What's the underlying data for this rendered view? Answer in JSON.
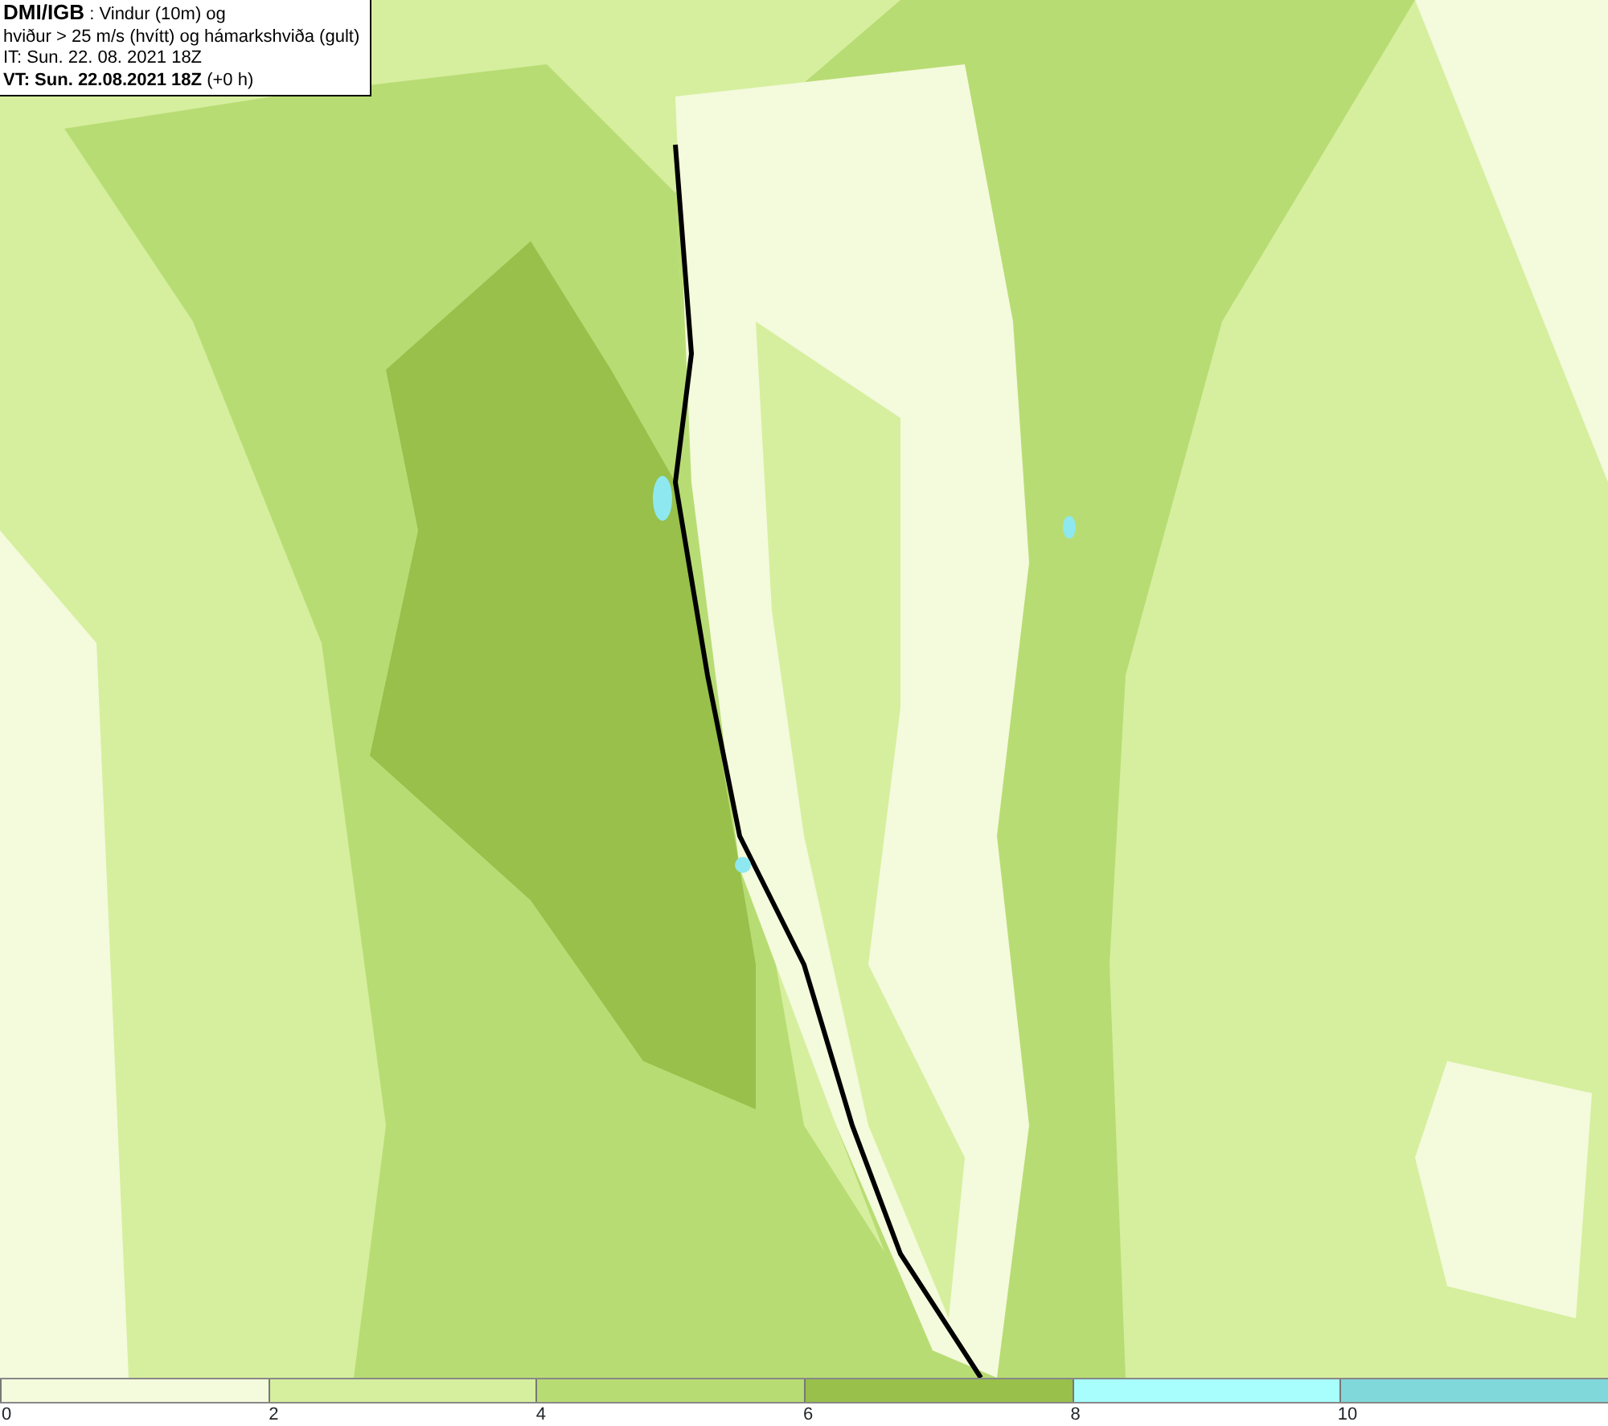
{
  "header": {
    "lines": [
      "**DMI/IGB** : Vindur (10m) og",
      "hviður > 25 m/s (hvítt) og hámarkshviða (gult)",
      "IT: Sun. 22. 08. 2021 18Z",
      "**VT: Sun. 22.08.2021 18Z** (+0 h)"
    ]
  },
  "legend": {
    "bins": [
      {
        "color": "#f4fadc"
      },
      {
        "color": "#d6ef9e"
      },
      {
        "color": "#b8dc74"
      },
      {
        "color": "#98c04a"
      },
      {
        "color": "#a8fdfd"
      },
      {
        "color": "#80d8da"
      }
    ],
    "ticks": [
      "0",
      "2",
      "4",
      "6",
      "8",
      "10"
    ]
  }
}
